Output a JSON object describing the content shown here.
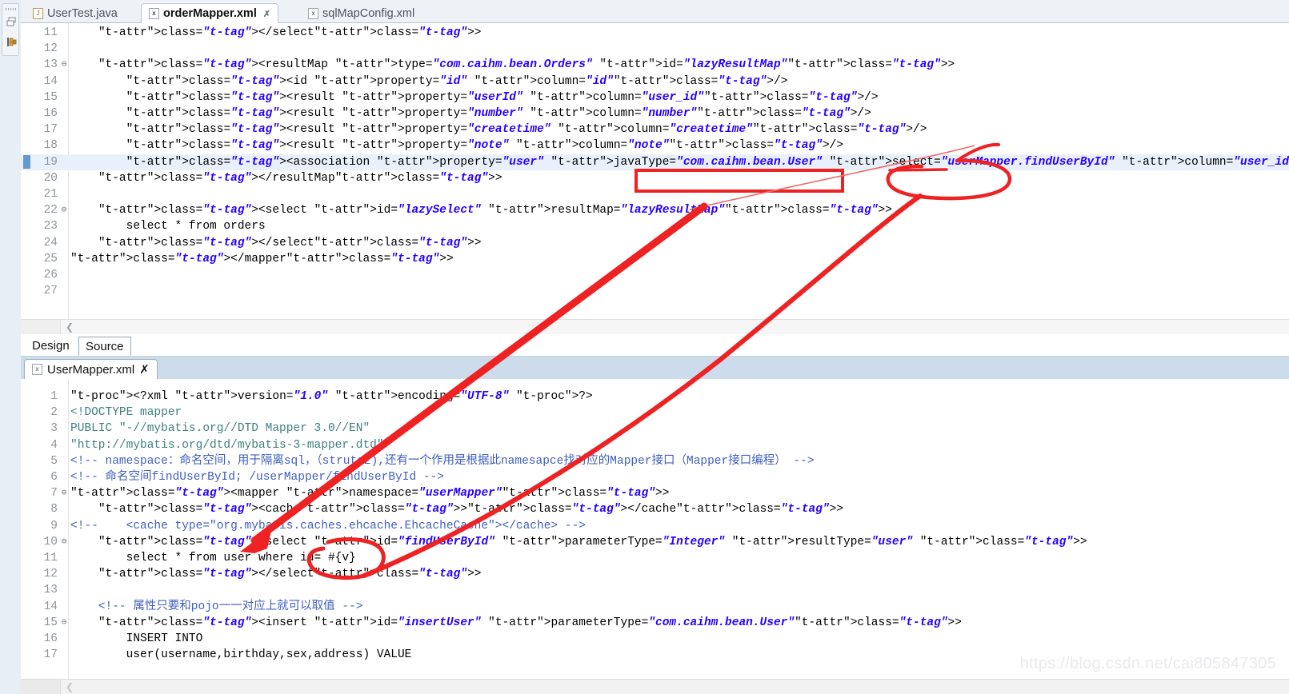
{
  "window": {
    "watermark": "https://blog.csdn.net/cai805847305"
  },
  "left_bar": {
    "icons": [
      {
        "name": "restore-view-icon",
        "glyph": "❐"
      },
      {
        "name": "package-explorer-icon",
        "glyph": "⌸"
      }
    ]
  },
  "top_editor": {
    "tabs": [
      {
        "label": "UserTest.java",
        "icon": "java-file-icon",
        "icon_glyph": "J",
        "active": false,
        "closable": false
      },
      {
        "label": "orderMapper.xml",
        "icon": "xml-file-icon",
        "icon_glyph": "x",
        "active": true,
        "closable": true,
        "close_glyph": "✗"
      },
      {
        "label": "sqlMapConfig.xml",
        "icon": "xml-file-icon",
        "icon_glyph": "x",
        "active": false,
        "closable": false
      }
    ],
    "first_line_number": 11,
    "highlighted_line": 19,
    "lines": [
      {
        "n": 11,
        "fold": "",
        "text": "    </select>"
      },
      {
        "n": 12,
        "fold": "",
        "text": ""
      },
      {
        "n": 13,
        "fold": "⊖",
        "text": "    <resultMap type=\"com.caihm.bean.Orders\" id=\"lazyResultMap\">"
      },
      {
        "n": 14,
        "fold": "",
        "text": "        <id property=\"id\" column=\"id\"/>"
      },
      {
        "n": 15,
        "fold": "",
        "text": "        <result property=\"userId\" column=\"user_id\"/>"
      },
      {
        "n": 16,
        "fold": "",
        "text": "        <result property=\"number\" column=\"number\"/>"
      },
      {
        "n": 17,
        "fold": "",
        "text": "        <result property=\"createtime\" column=\"createtime\"/>"
      },
      {
        "n": 18,
        "fold": "",
        "text": "        <result property=\"note\" column=\"note\"/>"
      },
      {
        "n": 19,
        "fold": "",
        "text": "        <association property=\"user\" javaType=\"com.caihm.bean.User\" select=\"userMapper.findUserById\" column=\"user_id\"></association>"
      },
      {
        "n": 20,
        "fold": "",
        "text": "    </resultMap>"
      },
      {
        "n": 21,
        "fold": "",
        "text": ""
      },
      {
        "n": 22,
        "fold": "⊖",
        "text": "    <select id=\"lazySelect\" resultMap=\"lazyResultMap\">"
      },
      {
        "n": 23,
        "fold": "",
        "text": "        select * from orders"
      },
      {
        "n": 24,
        "fold": "",
        "text": "    </select>"
      },
      {
        "n": 25,
        "fold": "",
        "text": "</mapper>"
      },
      {
        "n": 26,
        "fold": "",
        "text": ""
      },
      {
        "n": 27,
        "fold": "",
        "text": ""
      }
    ]
  },
  "design_source_tabs": [
    {
      "label": "Design",
      "active": false
    },
    {
      "label": "Source",
      "active": true
    }
  ],
  "bottom_editor": {
    "tab": {
      "label": "UserMapper.xml",
      "icon": "xml-file-icon",
      "icon_glyph": "x",
      "close_glyph": "✗"
    },
    "lines": [
      {
        "n": 1,
        "fold": "",
        "text": "<?xml version=\"1.0\" encoding=\"UTF-8\" ?>"
      },
      {
        "n": 2,
        "fold": "",
        "text": "<!DOCTYPE mapper"
      },
      {
        "n": 3,
        "fold": "",
        "text": "PUBLIC \"-//mybatis.org//DTD Mapper 3.0//EN\""
      },
      {
        "n": 4,
        "fold": "",
        "text": "\"http://mybatis.org/dtd/mybatis-3-mapper.dtd\">"
      },
      {
        "n": 5,
        "fold": "",
        "text": "<!-- namespace：命名空间，用于隔离sql，（struts2),还有一个作用是根据此namesapce找对应的Mapper接口（Mapper接口编程） -->"
      },
      {
        "n": 6,
        "fold": "",
        "text": "<!-- 命名空间findUserById; /userMapper/findUserById -->"
      },
      {
        "n": 7,
        "fold": "⊖",
        "text": "<mapper namespace=\"userMapper\">"
      },
      {
        "n": 8,
        "fold": "",
        "text": "    <cache></cache>"
      },
      {
        "n": 9,
        "fold": "",
        "text": "<!--    <cache type=\"org.mybatis.caches.ehcache.EhcacheCache\"></cache> -->"
      },
      {
        "n": 10,
        "fold": "⊖",
        "text": "    <select id=\"findUserById\" parameterType=\"Integer\" resultType=\"user\" >"
      },
      {
        "n": 11,
        "fold": "",
        "text": "        select * from user where id= #{v}"
      },
      {
        "n": 12,
        "fold": "",
        "text": "    </select>"
      },
      {
        "n": 13,
        "fold": "",
        "text": ""
      },
      {
        "n": 14,
        "fold": "",
        "text": "    <!-- 属性只要和pojo一一对应上就可以取值 -->"
      },
      {
        "n": 15,
        "fold": "⊖",
        "text": "    <insert id=\"insertUser\" parameterType=\"com.caihm.bean.User\">"
      },
      {
        "n": 16,
        "fold": "",
        "text": "        INSERT INTO"
      },
      {
        "n": 17,
        "fold": "",
        "text": "        user(username,birthday,sex,address) VALUE"
      }
    ]
  },
  "annotations": {
    "color": "#ee2222",
    "items": [
      {
        "name": "red-rect-select-attr",
        "shape": "rectangle",
        "target": "=\"userMapper.findUserById\""
      },
      {
        "name": "red-ellipse-column-attr",
        "shape": "ellipse",
        "target": "=\"user_id\">"
      },
      {
        "name": "red-ellipse-id-param",
        "shape": "ellipse",
        "target": "id= #{v}"
      },
      {
        "name": "red-arrow-select-to-findUserById",
        "shape": "arrow",
        "from": "select attribute",
        "to": "findUserById select id"
      },
      {
        "name": "red-arrow-column-to-param",
        "shape": "arrow",
        "from": "id= #{v}",
        "to": "column=\"user_id\""
      }
    ]
  }
}
